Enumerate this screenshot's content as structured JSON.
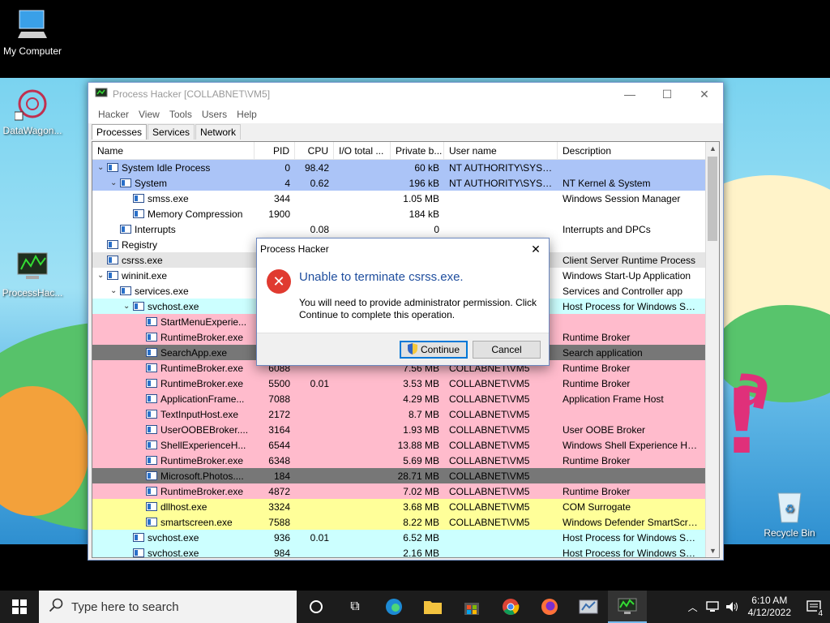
{
  "desktop": {
    "icons": [
      {
        "label": "My Computer"
      },
      {
        "label": "DataWagon..."
      },
      {
        "label": "ProcessHac..."
      },
      {
        "label": "Recycle Bin"
      }
    ]
  },
  "window": {
    "title": "Process Hacker [COLLABNET\\VM5]",
    "menu": [
      "Hacker",
      "View",
      "Tools",
      "Users",
      "Help"
    ],
    "tabs": [
      "Processes",
      "Services",
      "Network"
    ],
    "columns": [
      "Name",
      "PID",
      "CPU",
      "I/O total ...",
      "Private b...",
      "User name",
      "Description"
    ],
    "rows": [
      {
        "toggle": "v",
        "indent": 0,
        "name": "System Idle Process",
        "pid": "0",
        "cpu": "98.42",
        "io": "",
        "priv": "60 kB",
        "user": "NT AUTHORITY\\SYSTEM",
        "desc": "",
        "bg": "#abc4f7"
      },
      {
        "toggle": "v",
        "indent": 1,
        "name": "System",
        "pid": "4",
        "cpu": "0.62",
        "io": "",
        "priv": "196 kB",
        "user": "NT AUTHORITY\\SYSTEM",
        "desc": "NT Kernel & System",
        "bg": "#abc4f7"
      },
      {
        "toggle": "",
        "indent": 2,
        "name": "smss.exe",
        "pid": "344",
        "cpu": "",
        "io": "",
        "priv": "1.05 MB",
        "user": "",
        "desc": "Windows Session Manager",
        "bg": "#ffffff"
      },
      {
        "toggle": "",
        "indent": 2,
        "name": "Memory Compression",
        "pid": "1900",
        "cpu": "",
        "io": "",
        "priv": "184 kB",
        "user": "",
        "desc": "",
        "bg": "#ffffff"
      },
      {
        "toggle": "",
        "indent": 1,
        "name": "Interrupts",
        "pid": "",
        "cpu": "0.08",
        "io": "",
        "priv": "0",
        "user": "",
        "desc": "Interrupts and DPCs",
        "bg": "#ffffff"
      },
      {
        "toggle": "",
        "indent": 0,
        "name": "Registry",
        "pid": "",
        "cpu": "",
        "io": "",
        "priv": "",
        "user": "",
        "desc": "",
        "bg": "#ffffff"
      },
      {
        "toggle": "",
        "indent": 0,
        "name": "csrss.exe",
        "pid": "",
        "cpu": "",
        "io": "",
        "priv": "",
        "user": "",
        "desc": "Client Server Runtime Process",
        "bg": "#e5e5e5"
      },
      {
        "toggle": "v",
        "indent": 0,
        "name": "wininit.exe",
        "pid": "",
        "cpu": "",
        "io": "",
        "priv": "",
        "user": "",
        "desc": "Windows Start-Up Application",
        "bg": "#ffffff"
      },
      {
        "toggle": "v",
        "indent": 1,
        "name": "services.exe",
        "pid": "",
        "cpu": "",
        "io": "",
        "priv": "",
        "user": "",
        "desc": "Services and Controller app",
        "bg": "#ffffff"
      },
      {
        "toggle": "v",
        "indent": 2,
        "name": "svchost.exe",
        "pid": "",
        "cpu": "",
        "io": "",
        "priv": "",
        "user": "",
        "desc": "Host Process for Windows Ser...",
        "bg": "#ccffff"
      },
      {
        "toggle": "",
        "indent": 3,
        "name": "StartMenuExperie...",
        "pid": "",
        "cpu": "",
        "io": "",
        "priv": "",
        "user": "",
        "desc": "",
        "bg": "#ffbbcc"
      },
      {
        "toggle": "",
        "indent": 3,
        "name": "RuntimeBroker.exe",
        "pid": "",
        "cpu": "",
        "io": "",
        "priv": "",
        "user": "",
        "desc": "Runtime Broker",
        "bg": "#ffbbcc"
      },
      {
        "toggle": "",
        "indent": 3,
        "name": "SearchApp.exe",
        "pid": "",
        "cpu": "",
        "io": "",
        "priv": "",
        "user": "",
        "desc": "Search application",
        "bg": "#777777"
      },
      {
        "toggle": "",
        "indent": 3,
        "name": "RuntimeBroker.exe",
        "pid": "6088",
        "cpu": "",
        "io": "",
        "priv": "7.56 MB",
        "user": "COLLABNET\\VM5",
        "desc": "Runtime Broker",
        "bg": "#ffbbcc"
      },
      {
        "toggle": "",
        "indent": 3,
        "name": "RuntimeBroker.exe",
        "pid": "5500",
        "cpu": "0.01",
        "io": "",
        "priv": "3.53 MB",
        "user": "COLLABNET\\VM5",
        "desc": "Runtime Broker",
        "bg": "#ffbbcc"
      },
      {
        "toggle": "",
        "indent": 3,
        "name": "ApplicationFrame...",
        "pid": "7088",
        "cpu": "",
        "io": "",
        "priv": "4.29 MB",
        "user": "COLLABNET\\VM5",
        "desc": "Application Frame Host",
        "bg": "#ffbbcc"
      },
      {
        "toggle": "",
        "indent": 3,
        "name": "TextInputHost.exe",
        "pid": "2172",
        "cpu": "",
        "io": "",
        "priv": "8.7 MB",
        "user": "COLLABNET\\VM5",
        "desc": "",
        "bg": "#ffbbcc"
      },
      {
        "toggle": "",
        "indent": 3,
        "name": "UserOOBEBroker....",
        "pid": "3164",
        "cpu": "",
        "io": "",
        "priv": "1.93 MB",
        "user": "COLLABNET\\VM5",
        "desc": "User OOBE Broker",
        "bg": "#ffbbcc"
      },
      {
        "toggle": "",
        "indent": 3,
        "name": "ShellExperienceH...",
        "pid": "6544",
        "cpu": "",
        "io": "",
        "priv": "13.88 MB",
        "user": "COLLABNET\\VM5",
        "desc": "Windows Shell Experience Host",
        "bg": "#ffbbcc"
      },
      {
        "toggle": "",
        "indent": 3,
        "name": "RuntimeBroker.exe",
        "pid": "6348",
        "cpu": "",
        "io": "",
        "priv": "5.69 MB",
        "user": "COLLABNET\\VM5",
        "desc": "Runtime Broker",
        "bg": "#ffbbcc"
      },
      {
        "toggle": "",
        "indent": 3,
        "name": "Microsoft.Photos....",
        "pid": "184",
        "cpu": "",
        "io": "",
        "priv": "28.71 MB",
        "user": "COLLABNET\\VM5",
        "desc": "",
        "bg": "#777777"
      },
      {
        "toggle": "",
        "indent": 3,
        "name": "RuntimeBroker.exe",
        "pid": "4872",
        "cpu": "",
        "io": "",
        "priv": "7.02 MB",
        "user": "COLLABNET\\VM5",
        "desc": "Runtime Broker",
        "bg": "#ffbbcc"
      },
      {
        "toggle": "",
        "indent": 3,
        "name": "dllhost.exe",
        "pid": "3324",
        "cpu": "",
        "io": "",
        "priv": "3.68 MB",
        "user": "COLLABNET\\VM5",
        "desc": "COM Surrogate",
        "bg": "#ffff99"
      },
      {
        "toggle": "",
        "indent": 3,
        "name": "smartscreen.exe",
        "pid": "7588",
        "cpu": "",
        "io": "",
        "priv": "8.22 MB",
        "user": "COLLABNET\\VM5",
        "desc": "Windows Defender SmartScre...",
        "bg": "#ffff99"
      },
      {
        "toggle": "",
        "indent": 2,
        "name": "svchost.exe",
        "pid": "936",
        "cpu": "0.01",
        "io": "",
        "priv": "6.52 MB",
        "user": "",
        "desc": "Host Process for Windows Ser...",
        "bg": "#ccffff"
      },
      {
        "toggle": "",
        "indent": 2,
        "name": "svchost.exe",
        "pid": "984",
        "cpu": "",
        "io": "",
        "priv": "2.16 MB",
        "user": "",
        "desc": "Host Process for Windows Ser...",
        "bg": "#ccffff"
      }
    ]
  },
  "dialog": {
    "title": "Process Hacker",
    "heading": "Unable to terminate csrss.exe.",
    "body": "You will need to provide administrator permission. Click Continue to complete this operation.",
    "continue_label": "Continue",
    "cancel_label": "Cancel"
  },
  "taskbar": {
    "search_placeholder": "Type here to search",
    "time": "6:10 AM",
    "date": "4/12/2022",
    "notification_count": "4"
  },
  "colors": {
    "accent": "#0078d7",
    "error": "#e03a30",
    "heading_blue": "#1f4e9e"
  }
}
